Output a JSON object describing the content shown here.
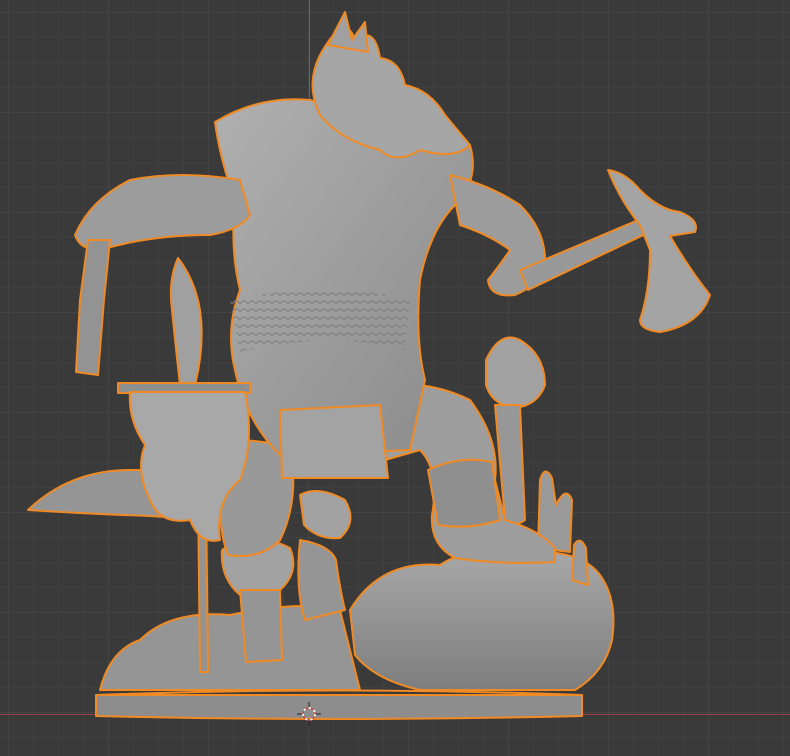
{
  "viewport": {
    "type": "3d-viewport",
    "grid": true,
    "object": "lizardfolk-warrior-miniature",
    "selected": true,
    "colors": {
      "background": "#3a3a3a",
      "grid_minor": "#404040",
      "grid_major": "#444444",
      "x_axis": "#9a3b46",
      "y_axis": "#3d6eaa",
      "mesh": "#9c9c9c",
      "selection_outline": "#f08a24"
    },
    "icons": {
      "cursor": "3d-cursor-icon"
    }
  }
}
